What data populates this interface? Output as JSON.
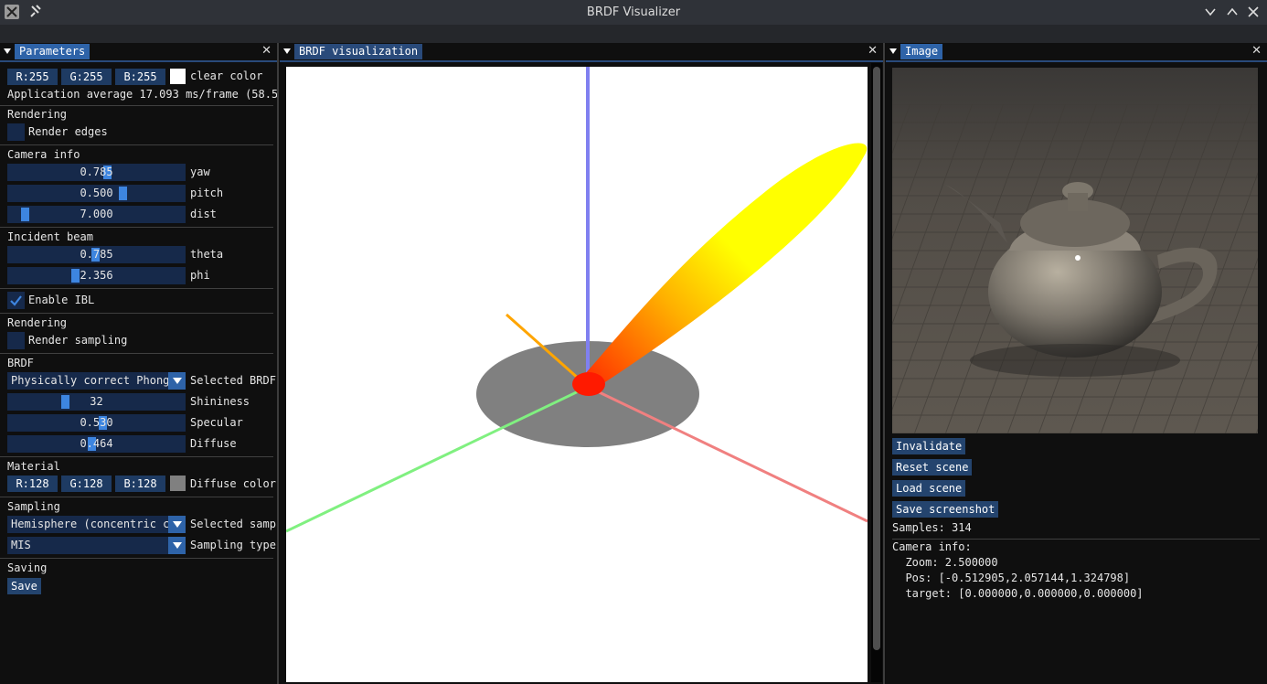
{
  "window": {
    "title": "BRDF Visualizer"
  },
  "parameters": {
    "tab_label": "Parameters",
    "clear_r": "R:255",
    "clear_g": "G:255",
    "clear_b": "B:255",
    "clear_label": "clear color",
    "perf_text": "Application average 17.093 ms/frame (58.5",
    "rendering_header": "Rendering",
    "render_edges_label": "Render edges",
    "camera_header": "Camera info",
    "yaw_value": "0.785",
    "yaw_label": "yaw",
    "pitch_value": "0.500",
    "pitch_label": "pitch",
    "dist_value": "7.000",
    "dist_label": "dist",
    "incident_header": "Incident beam",
    "theta_value": "0.785",
    "theta_label": "theta",
    "phi_value": "2.356",
    "phi_label": "phi",
    "ibl_label": "Enable IBL",
    "rendering2_header": "Rendering",
    "render_sampling_label": "Render sampling",
    "brdf_header": "BRDF",
    "brdf_selected_value": "Physically correct Phong",
    "brdf_selected_label": "Selected BRDF",
    "shininess_value": "32",
    "shininess_label": "Shininess",
    "specular_value": "0.530",
    "specular_label": "Specular",
    "diffuse_value": "0.464",
    "diffuse_label": "Diffuse",
    "material_header": "Material",
    "diff_r": "R:128",
    "diff_g": "G:128",
    "diff_b": "B:128",
    "diffuse_color_label": "Diffuse color",
    "sampling_header": "Sampling",
    "sampler_value": "Hemisphere (concentric cc",
    "sampler_label": "Selected samp",
    "sampling_type_value": "MIS",
    "sampling_type_label": "Sampling type",
    "saving_header": "Saving",
    "save_label": "Save"
  },
  "visualization": {
    "tab_label": "BRDF visualization"
  },
  "image": {
    "tab_label": "Image",
    "invalidate_label": "Invalidate",
    "reset_label": "Reset scene",
    "load_label": "Load scene",
    "screenshot_label": "Save screenshot",
    "samples_text": "Samples: 314",
    "camera_header": "Camera info:",
    "zoom_text": "  Zoom: 2.500000",
    "pos_text": "  Pos: [-0.512905,2.057144,1.324798]",
    "target_text": "  target: [0.000000,0.000000,0.000000]"
  },
  "sliders": {
    "yaw": 0.785,
    "pitch": 0.5,
    "dist": 7.0,
    "theta": 0.785,
    "phi": 2.356,
    "shininess": 32,
    "specular": 0.53,
    "diffuse": 0.464
  },
  "colors": {
    "clear_color": "#ffffff",
    "diffuse_color": "#808080",
    "accent": "#3d85e0",
    "frame_bg": "#16294a",
    "axis_x": "#f08080",
    "axis_y": "#80f080",
    "axis_z": "#8080f0",
    "incident": "#ffa500",
    "lobe": "#ffff00"
  },
  "icons": {
    "app": "app-icon",
    "pin": "pin-icon",
    "minimize": "chevron-down-icon",
    "maximize": "chevron-up-icon",
    "close": "close-icon",
    "collapse": "collapse-triangle-icon",
    "check": "checkmark-icon",
    "dropdown": "dropdown-arrow-icon"
  }
}
